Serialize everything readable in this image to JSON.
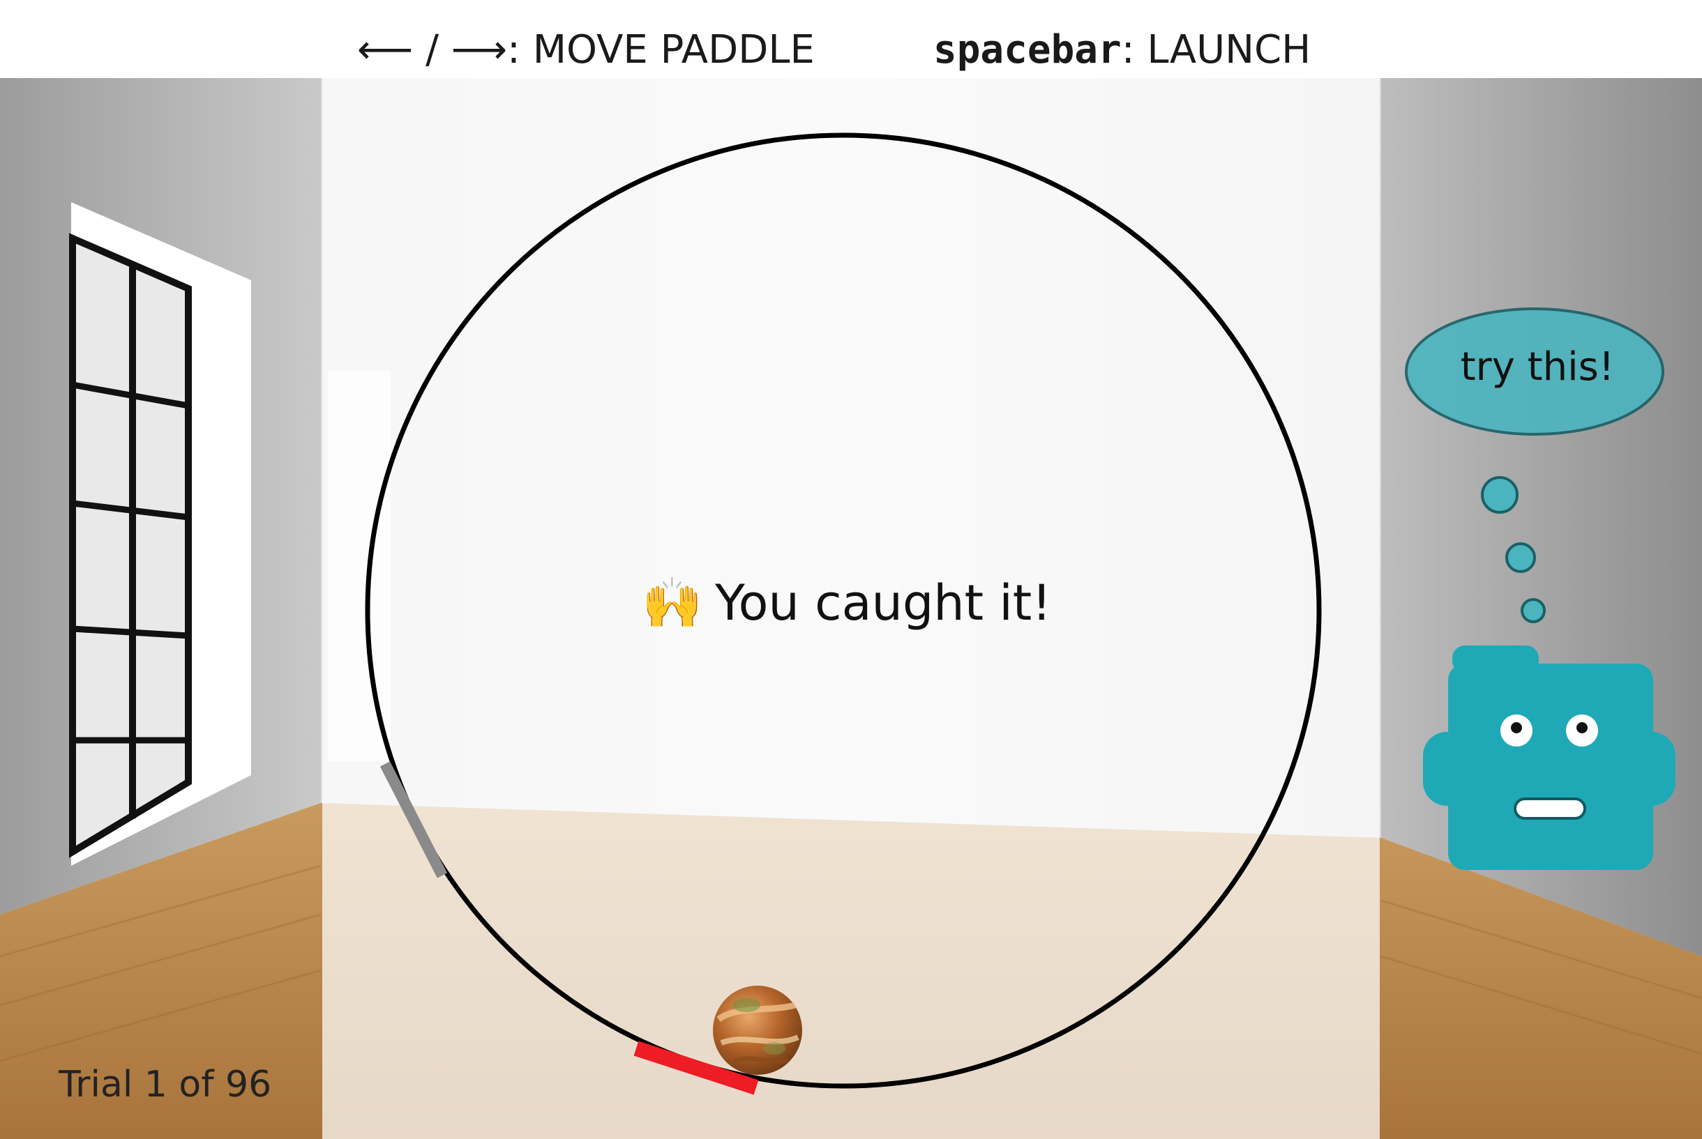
{
  "instructions": {
    "move_keys": "⟵ / ⟶",
    "move_label": ": MOVE PADDLE",
    "launch_key": "spacebar",
    "launch_label": ": LAUNCH"
  },
  "game": {
    "feedback_emoji": "🙌",
    "feedback_text": "You caught it!",
    "trial_label": "Trial 1 of 96",
    "trial_current": 1,
    "trial_total": 96
  },
  "helper": {
    "bubble_text": "try this!",
    "robot_icon": "robot-face-icon"
  },
  "colors": {
    "ring": "#000000",
    "paddle_player": "#ee1c24",
    "paddle_hint": "#8a8a8a",
    "robot": "#1fa9b6",
    "bubble": "#4bb5bf",
    "ball": "#b5652a"
  },
  "icons": {
    "ball": "planet-ball-icon",
    "feedback": "raised-hands-icon"
  }
}
